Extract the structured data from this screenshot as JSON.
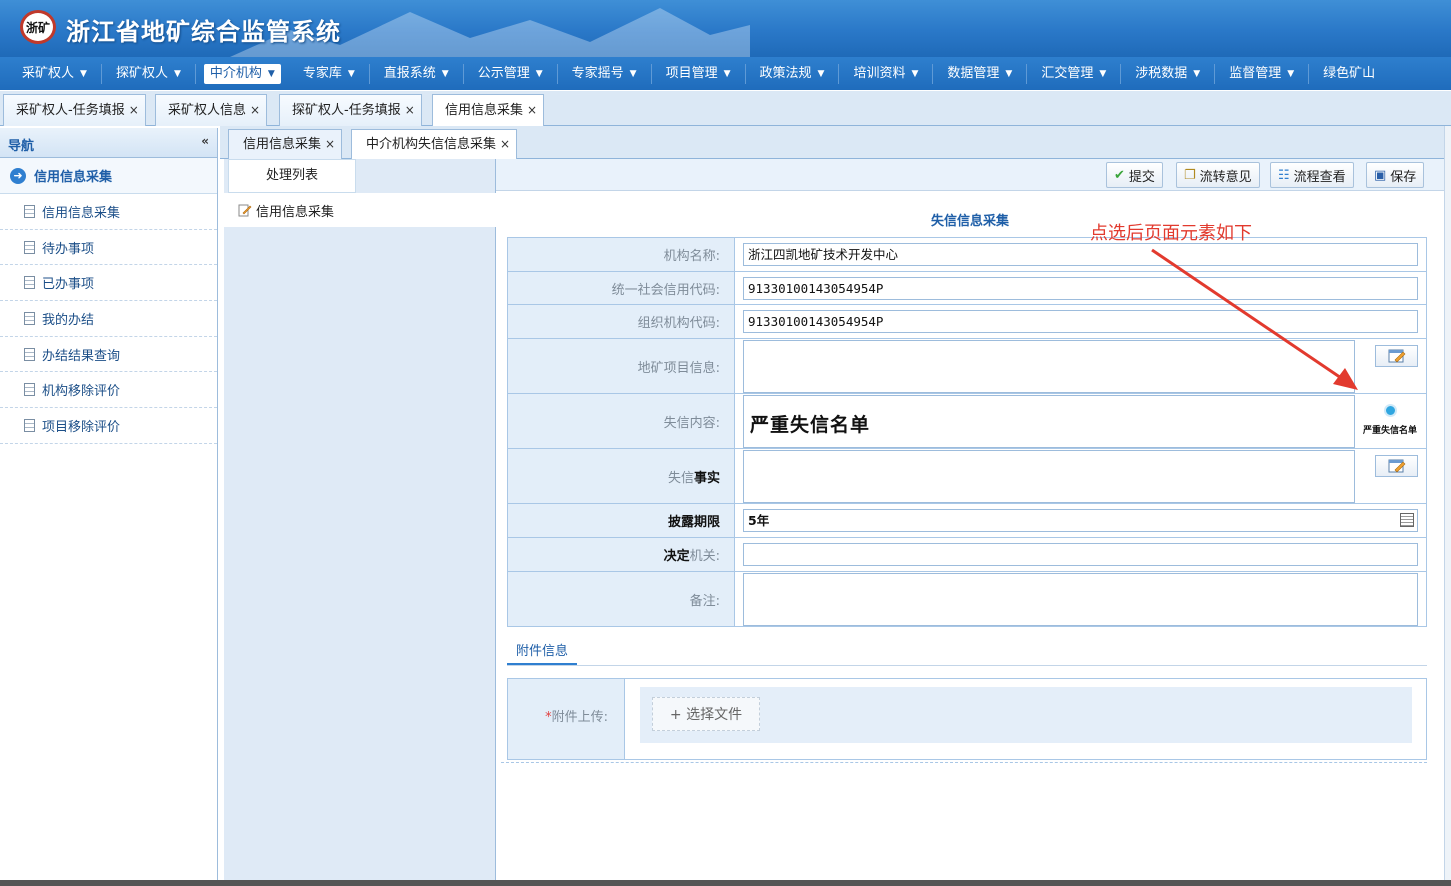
{
  "app": {
    "title": "浙江省地矿综合监管系统",
    "logo_text": "浙矿"
  },
  "menu": [
    {
      "label": "采矿权人",
      "caret": "▼"
    },
    {
      "label": "探矿权人",
      "caret": "▼"
    },
    {
      "label": "中介机构",
      "caret": "▼",
      "active": true
    },
    {
      "label": "专家库",
      "caret": "▼"
    },
    {
      "label": "直报系统",
      "caret": "▼"
    },
    {
      "label": "公示管理",
      "caret": "▼"
    },
    {
      "label": "专家摇号",
      "caret": "▼"
    },
    {
      "label": "项目管理",
      "caret": "▼"
    },
    {
      "label": "政策法规",
      "caret": "▼"
    },
    {
      "label": "培训资料",
      "caret": "▼"
    },
    {
      "label": "数据管理",
      "caret": "▼"
    },
    {
      "label": "汇交管理",
      "caret": "▼"
    },
    {
      "label": "涉税数据",
      "caret": "▼"
    },
    {
      "label": "监督管理",
      "caret": "▼"
    },
    {
      "label": "绿色矿山",
      "caret": ""
    }
  ],
  "top_tabs": [
    "采矿权人-任务填报",
    "采矿权人信息",
    "探矿权人-任务填报",
    "信用信息采集"
  ],
  "close_glyph": "×",
  "sidebar": {
    "title": "导航",
    "collapse": "«",
    "group": "信用信息采集",
    "items": [
      "信用信息采集",
      "待办事项",
      "已办事项",
      "我的办结",
      "办结结果查询",
      "机构移除评价",
      "项目移除评价"
    ]
  },
  "sub_tabs": [
    "信用信息采集",
    "中介机构失信信息采集"
  ],
  "list": {
    "tab": "处理列表",
    "row": "信用信息采集"
  },
  "toolbar": {
    "submit": "提交",
    "opinion": "流转意见",
    "flow": "流程查看",
    "save": "保存"
  },
  "form": {
    "title": "失信信息采集",
    "org_name_label": "机构名称:",
    "org_name": "浙江四凯地矿技术开发中心",
    "credit_code_label": "统一社会信用代码:",
    "credit_code": "91330100143054954P",
    "org_code_label": "组织机构代码:",
    "org_code": "91330100143054954P",
    "project_label": "地矿项目信息:",
    "content_label": "失信内容:",
    "content": "严重失信名单",
    "badge": "严重失信名单",
    "fact_label_a": "失信",
    "fact_label_b": "事实",
    "expose_label": "披露期限",
    "expose": "5年",
    "decide_label_a": "决定",
    "decide_label_b": "机关:",
    "remark_label": "备注:"
  },
  "attach": {
    "tab": "附件信息",
    "req": "*",
    "label": "附件上传:",
    "choose": "+ 选择文件"
  },
  "annotation": "点选后页面元素如下",
  "colors": {
    "header": "#2a78c8",
    "accent": "#1f5fa8",
    "annotation": "#e23a2e"
  }
}
